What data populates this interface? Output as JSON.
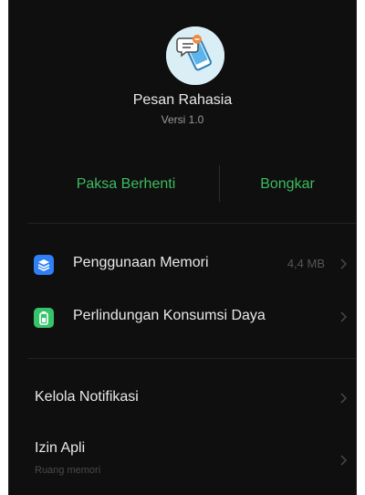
{
  "app": {
    "name": "Pesan Rahasia",
    "version": "Versi 1.0",
    "icon": "chat-phone-icon"
  },
  "actions": {
    "force_stop_label": "Paksa Berhenti",
    "uninstall_label": "Bongkar"
  },
  "settings": {
    "memory": {
      "label": "Penggunaan Memori",
      "value": "4,4 MB",
      "icon": "layers-icon",
      "icon_color": "#2f7ff5"
    },
    "power": {
      "label": "Perlindungan Konsumsi Daya",
      "icon": "battery-icon",
      "icon_color": "#35c46a"
    },
    "notifications": {
      "label": "Kelola Notifikasi"
    },
    "permissions": {
      "label": "Izin Apli",
      "sublabel": "Ruang memori"
    }
  },
  "colors": {
    "background": "#0f0f0f",
    "accent": "#3dbb5f",
    "text": "#e8e8e8"
  }
}
